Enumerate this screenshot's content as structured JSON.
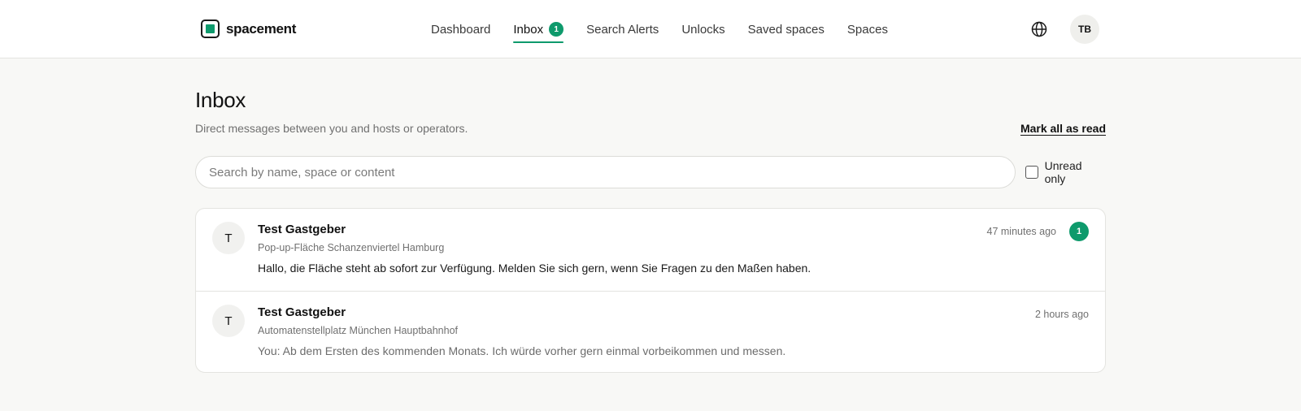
{
  "brand": {
    "name": "spacement",
    "accent_color": "#0e9a6c"
  },
  "nav": {
    "items": [
      {
        "label": "Dashboard",
        "active": false
      },
      {
        "label": "Inbox",
        "active": true,
        "badge": "1"
      },
      {
        "label": "Search Alerts",
        "active": false
      },
      {
        "label": "Unlocks",
        "active": false
      },
      {
        "label": "Saved spaces",
        "active": false
      },
      {
        "label": "Spaces",
        "active": false
      }
    ],
    "language_icon": "globe-icon",
    "user_initials": "TB"
  },
  "page": {
    "title": "Inbox",
    "subtitle": "Direct messages between you and hosts or operators.",
    "mark_all_read_label": "Mark all as read"
  },
  "filters": {
    "search_placeholder": "Search by name, space or content",
    "search_value": "",
    "unread_only_label": "Unread only",
    "unread_only_checked": false
  },
  "threads": [
    {
      "avatar_initial": "T",
      "name": "Test Gastgeber",
      "space": "Pop-up-Fläche Schanzenviertel Hamburg",
      "preview": "Hallo, die Fläche steht ab sofort zur Verfügung. Melden Sie sich gern, wenn Sie Fragen zu den Maßen haben.",
      "time": "47 minutes ago",
      "unread_count": "1"
    },
    {
      "avatar_initial": "T",
      "name": "Test Gastgeber",
      "space": "Automatenstellplatz München Hauptbahnhof",
      "preview": "You: Ab dem Ersten des kommenden Monats. Ich würde vorher gern einmal vorbeikommen und messen.",
      "time": "2 hours ago",
      "unread_count": ""
    }
  ]
}
